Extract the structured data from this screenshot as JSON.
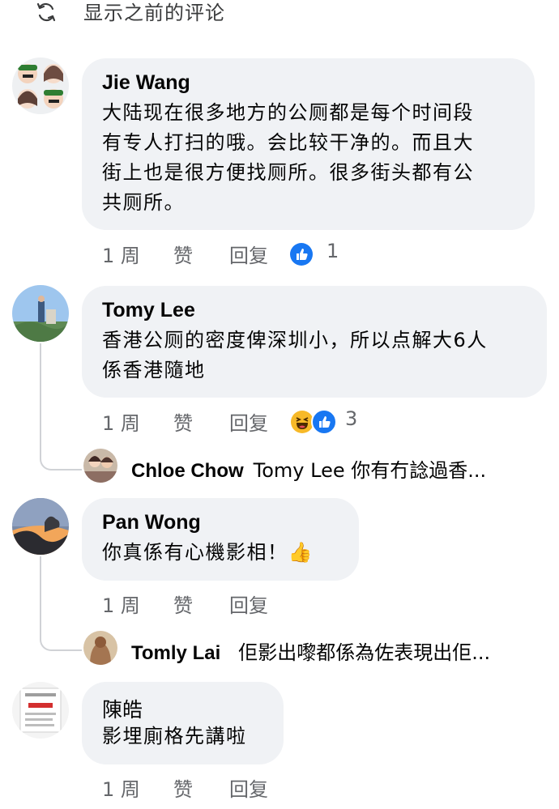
{
  "header": {
    "show_previous_label": "显示之前的评论"
  },
  "comments": [
    {
      "author": "Jie Wang",
      "lines": [
        "大陆现在很多地方的公厕都是每个时间段",
        "有专人打扫的哦。会比较干净的。而且大",
        "街上也是很方便找厕所。很多街头都有公",
        "共厕所。"
      ],
      "time": "1 周",
      "like_label": "赞",
      "reply_label": "回复",
      "reactions": [
        "like"
      ],
      "reaction_count": "1"
    },
    {
      "author": "Tomy Lee",
      "lines": [
        "香港公厕的密度俾深圳小，所以点解大6人",
        "係香港隨地"
      ],
      "time": "1 周",
      "like_label": "赞",
      "reply_label": "回复",
      "reactions": [
        "haha",
        "like"
      ],
      "reaction_count": "3",
      "reply_preview": {
        "author": "Chloe Chow",
        "text": "Tomy Lee 你有冇諗過香..."
      }
    },
    {
      "author": "Pan Wong",
      "lines": [
        "你真係有心機影相！👍"
      ],
      "time": "1 周",
      "like_label": "赞",
      "reply_label": "回复",
      "reply_preview": {
        "author": "Tomly Lai",
        "text": "佢影出嚟都係為佐表現出佢..."
      }
    },
    {
      "author": "陳皓",
      "lines": [
        "影埋廁格先講啦"
      ],
      "time": "1 周",
      "like_label": "赞",
      "reply_label": "回复"
    }
  ],
  "colors": {
    "bubble": "#f0f2f5",
    "meta": "#65676b",
    "like_blue": "#1877f2",
    "haha_yellow": "#f7b928"
  }
}
